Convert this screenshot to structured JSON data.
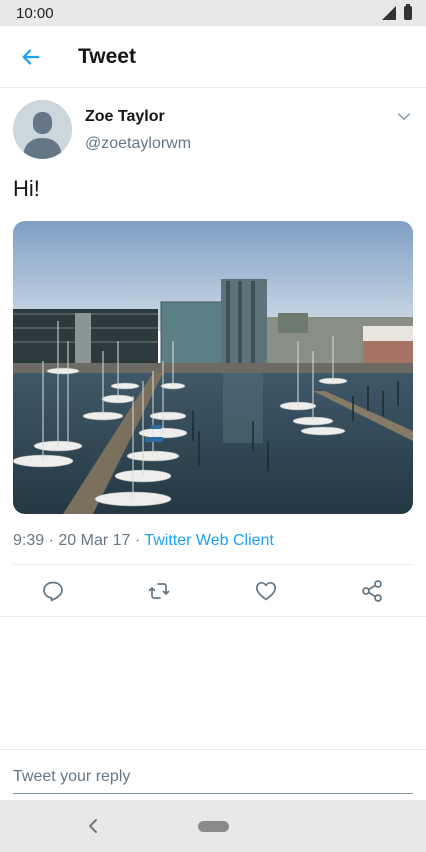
{
  "status_bar": {
    "time": "10:00"
  },
  "header": {
    "title": "Tweet"
  },
  "tweet": {
    "author_name": "Zoe Taylor",
    "author_handle": "@zoetaylorwm",
    "text": "Hi!",
    "time": "9:39",
    "date": "20 Mar 17",
    "separator": "·",
    "source": "Twitter Web Client"
  },
  "actions": [
    "reply-icon",
    "retweet-icon",
    "like-icon",
    "share-icon"
  ],
  "reply": {
    "placeholder": "Tweet your reply"
  },
  "colors": {
    "accent": "#1da1f2",
    "text_secondary": "#657786",
    "divider": "#e6ecf0"
  }
}
